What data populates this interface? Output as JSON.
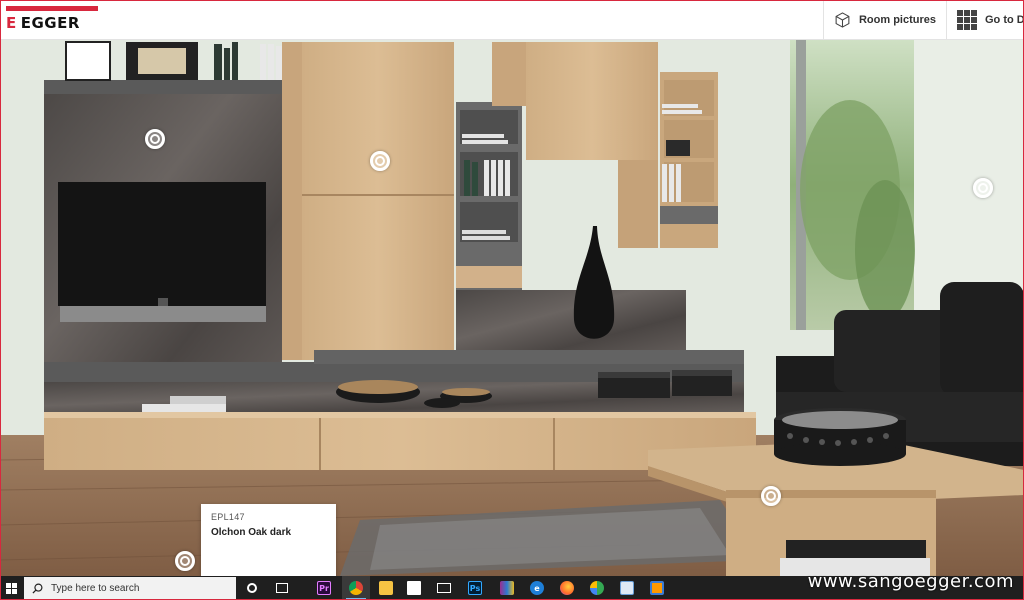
{
  "header": {
    "logo_text": "EGGER",
    "room_pictures_label": "Room pictures",
    "goto_label": "Go to De"
  },
  "card": {
    "code": "EPL147",
    "name": "Olchon Oak dark"
  },
  "taskbar": {
    "search_placeholder": "Type here to search",
    "apps": [
      "task-view",
      "premiere-pro",
      "chrome",
      "file-explorer",
      "store",
      "mail",
      "photoshop",
      "winrar",
      "edge",
      "firefox",
      "media-player",
      "notepad",
      "sublime"
    ]
  },
  "watermark": "www.sangoegger.com",
  "colors": {
    "brand_red": "#d8283e",
    "oak": "#d2b48c",
    "stone": "#585350"
  }
}
